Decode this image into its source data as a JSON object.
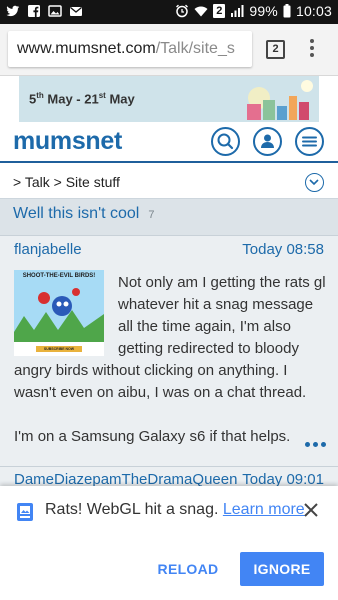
{
  "status_bar": {
    "battery": "99%",
    "time": "10:03",
    "sim": "2",
    "icons": [
      "twitter-icon",
      "facebook-icon",
      "photos-icon",
      "mail-icon",
      "alarm-icon",
      "wifi-icon",
      "signal-icon",
      "battery-icon"
    ]
  },
  "browser": {
    "url_host": "www.mumsnet.com",
    "url_path": "/Talk/site_s",
    "tab_count": "2"
  },
  "ad": {
    "text": "5th May - 21st May"
  },
  "header": {
    "logo": "mumsnet"
  },
  "breadcrumb": {
    "talk": "Talk",
    "section": "Site stuff"
  },
  "thread": {
    "title": "Well this isn't cool",
    "count": "7"
  },
  "post": {
    "author": "flanjabelle",
    "time": "Today 08:58",
    "image_title": "SHOOT-THE-EVIL BIRDS!",
    "image_button": "SUBSCRIBE NOW",
    "paragraphs": [
      "Not only am I getting the rats gl whatever hit a snag message all the time again, I'm also getting redirected to bloody angry birds without clicking on anything. I wasn't even on aibu, I was on a chat thread.",
      "I'm on a Samsung Galaxy s6 if that helps."
    ]
  },
  "next_post": {
    "author": "DameDiazepamTheDramaQueen",
    "time": "Today 09:01"
  },
  "infobar": {
    "message": "Rats! WebGL hit a snag.",
    "link": "Learn more",
    "reload": "RELOAD",
    "ignore": "IGNORE"
  },
  "colors": {
    "brand": "#1d6aaa",
    "chrome_blue": "#4285f4",
    "thread_bg": "#dce3e8"
  }
}
